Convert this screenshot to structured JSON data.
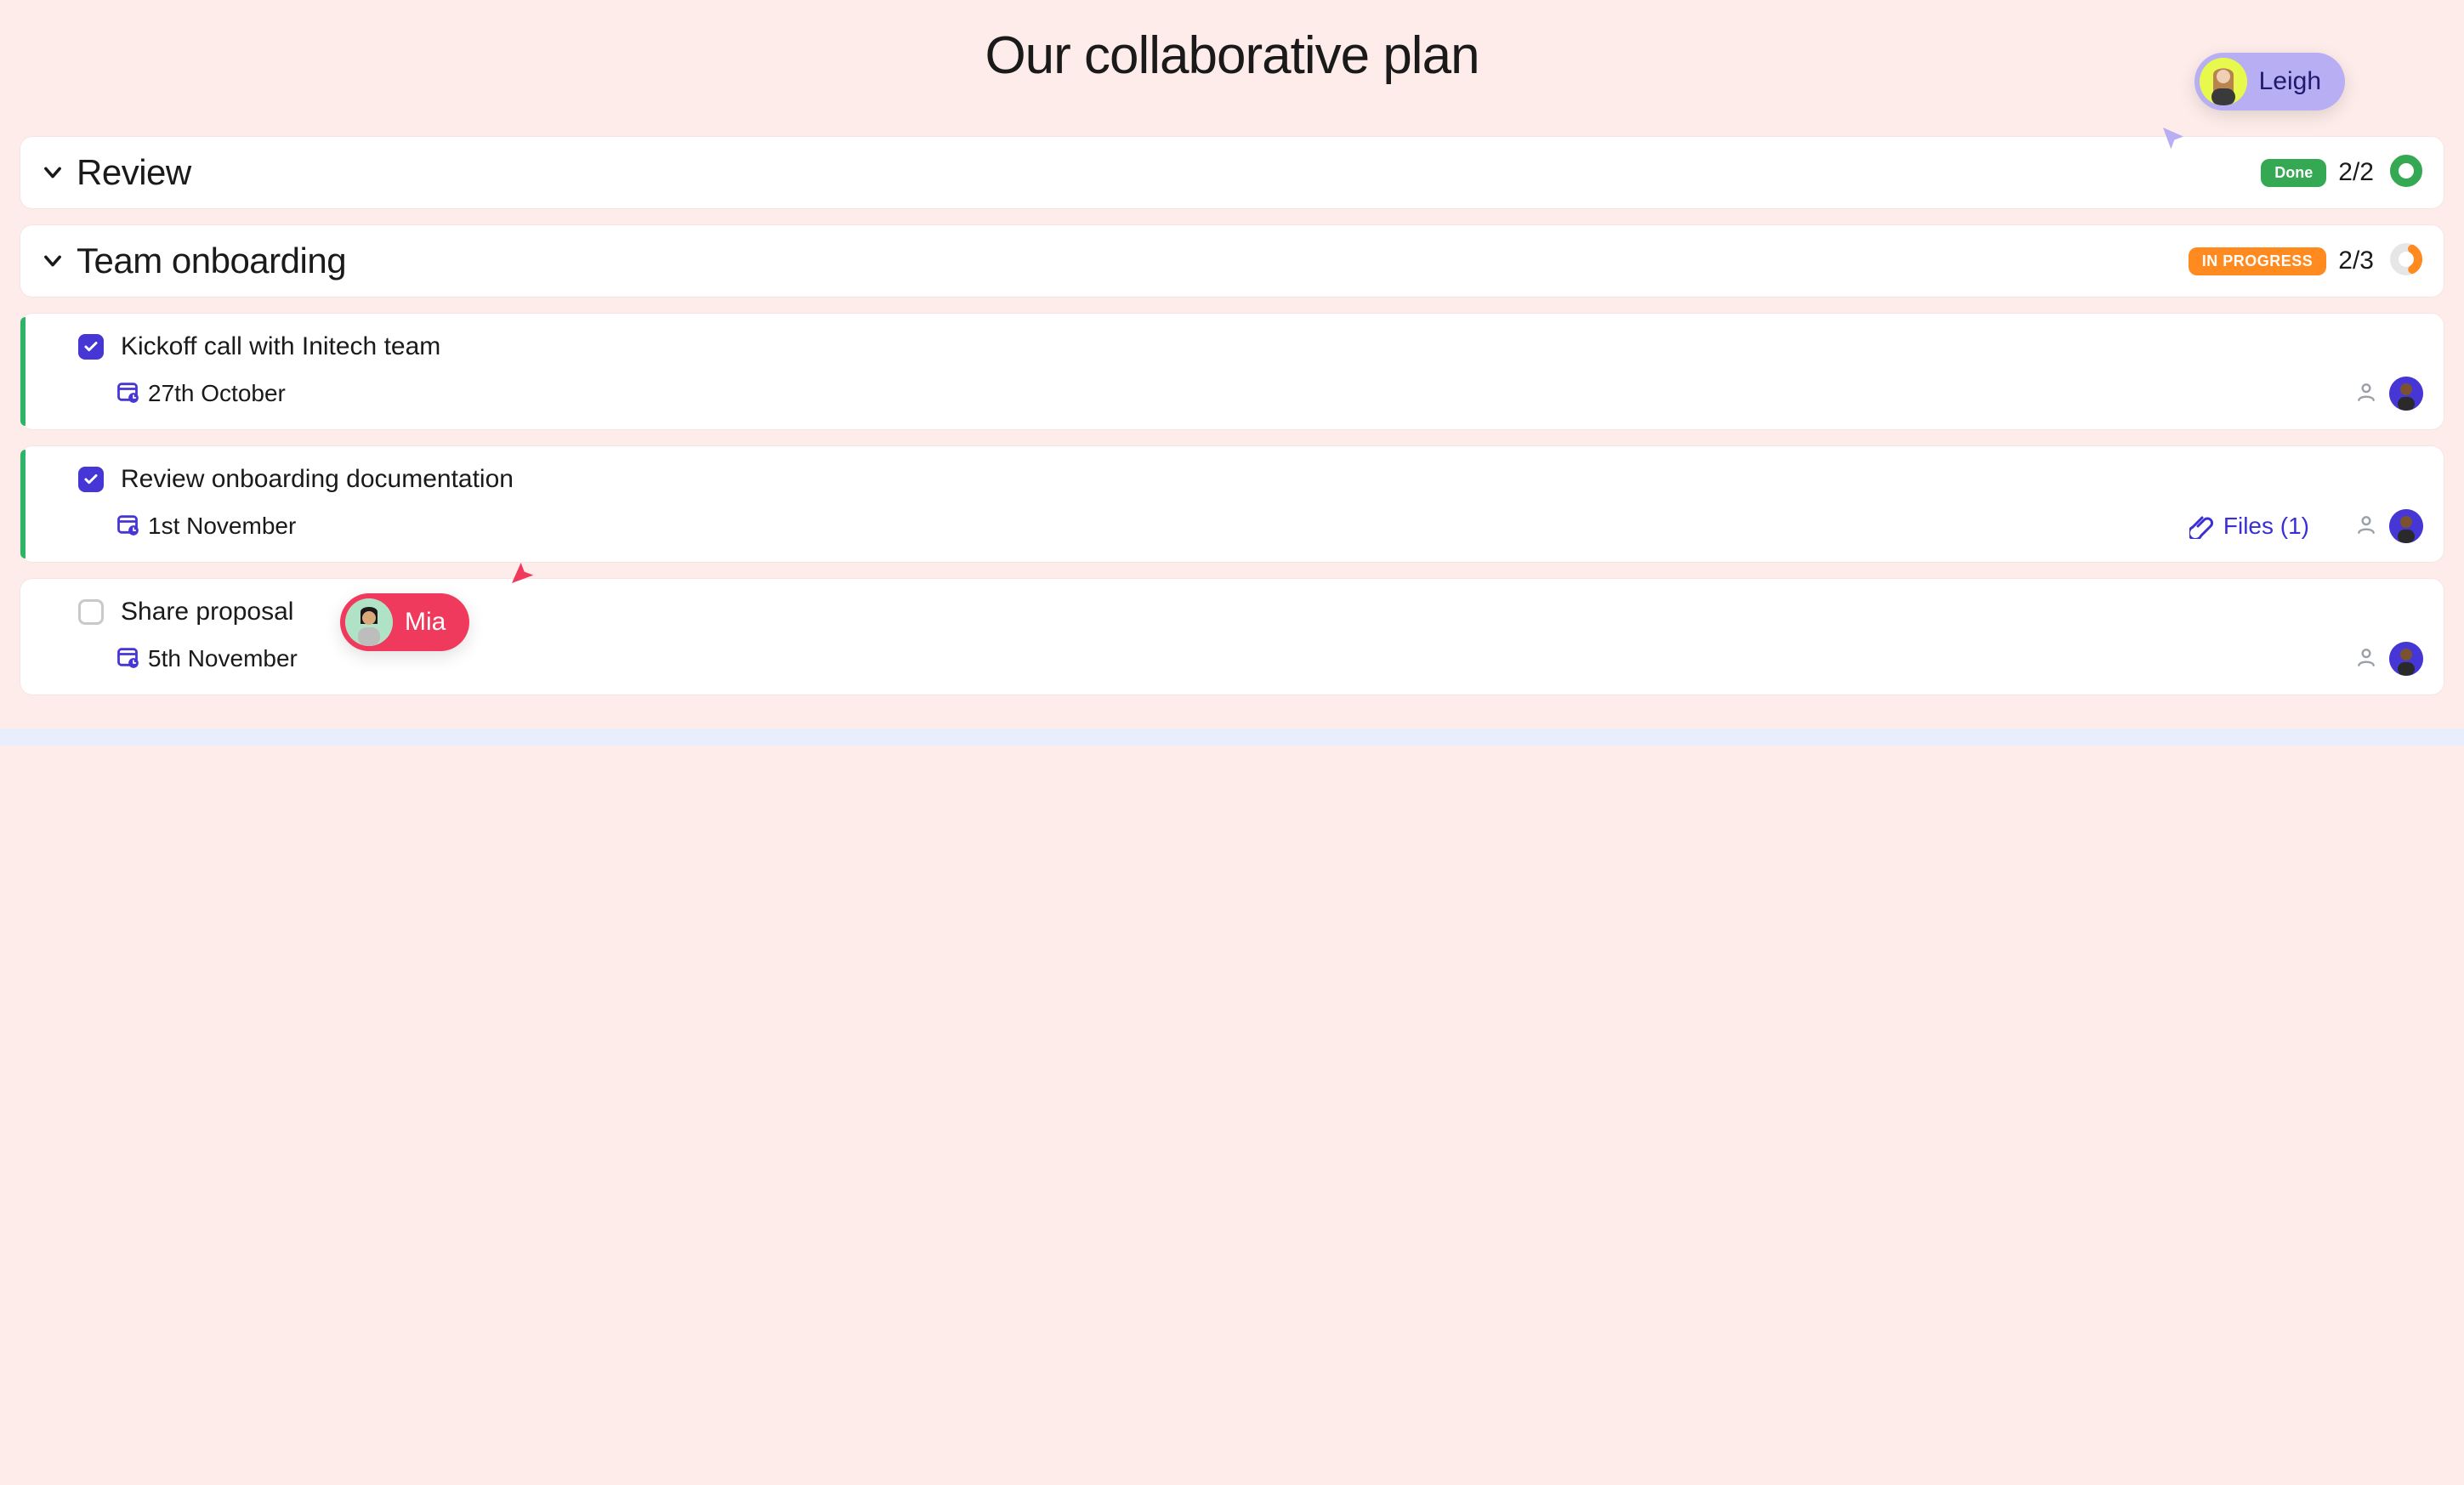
{
  "title": "Our collaborative plan",
  "collaborators": {
    "leigh": {
      "name": "Leigh"
    },
    "mia": {
      "name": "Mia"
    }
  },
  "sections": [
    {
      "name": "Review",
      "status_label": "Done",
      "status_style": "green",
      "count": "2/2",
      "progress": 1.0
    },
    {
      "name": "Team onboarding",
      "status_label": "IN PROGRESS",
      "status_style": "orange",
      "count": "2/3",
      "progress": 0.33
    }
  ],
  "tasks": [
    {
      "title": "Kickoff call with Initech team",
      "date": "27th October",
      "checked": true,
      "files_label": null
    },
    {
      "title": "Review onboarding documentation",
      "date": "1st November",
      "checked": true,
      "files_label": "Files (1)"
    },
    {
      "title": "Share proposal",
      "date": "5th November",
      "checked": false,
      "files_label": null
    }
  ],
  "colors": {
    "primary": "#4636d6",
    "green": "#34a853",
    "orange": "#ff8a1f",
    "red": "#ef3a5d",
    "lavender": "#b8aef3"
  }
}
